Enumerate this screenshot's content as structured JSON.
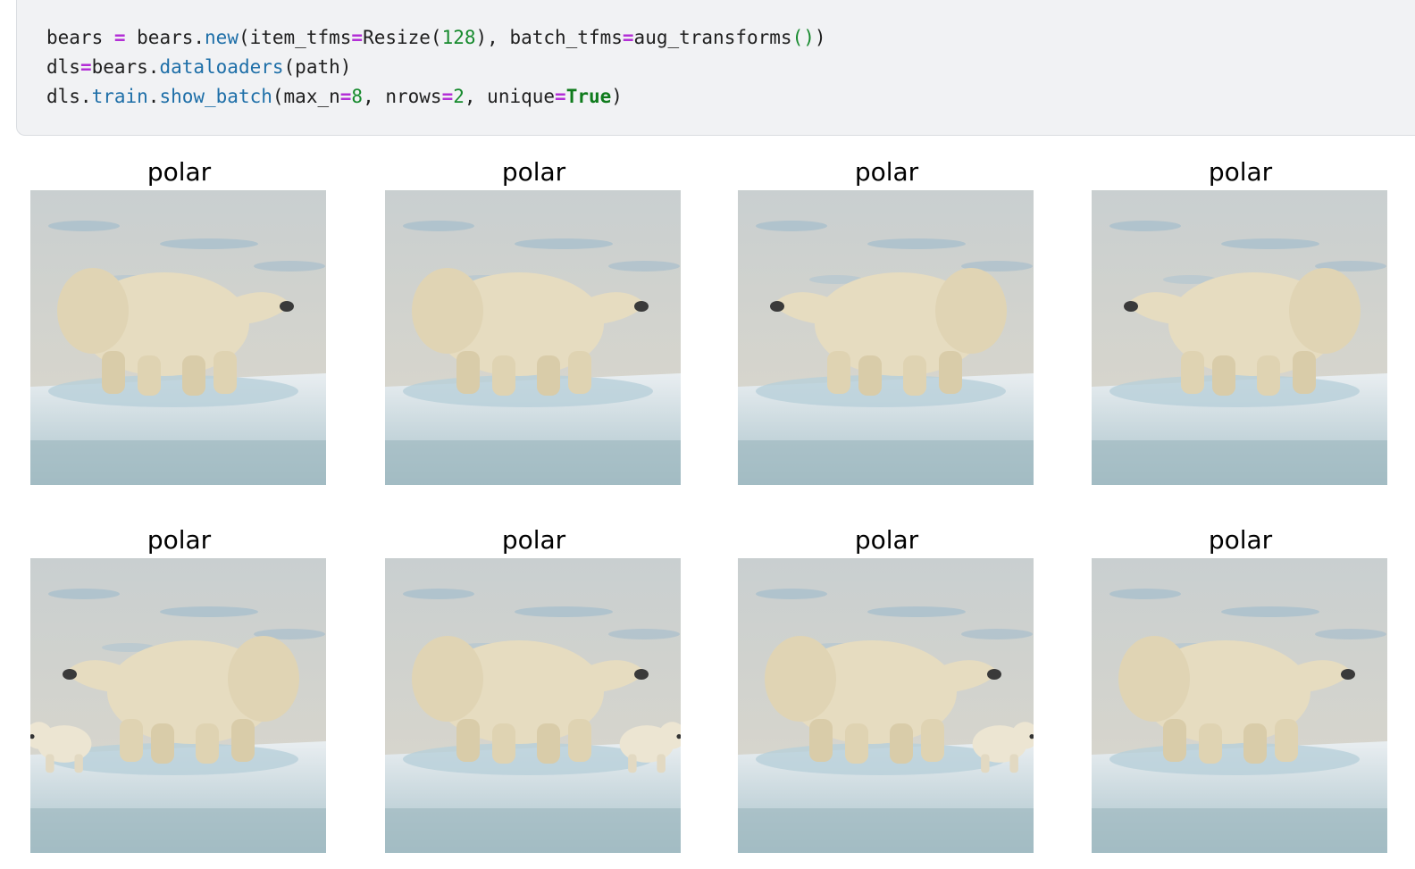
{
  "code_cell": {
    "lines": [
      [
        {
          "t": "bears ",
          "c": ""
        },
        {
          "t": "=",
          "c": "op"
        },
        {
          "t": " bears.",
          "c": ""
        },
        {
          "t": "new",
          "c": "fn"
        },
        {
          "t": "(item_tfms",
          "c": ""
        },
        {
          "t": "=",
          "c": "op"
        },
        {
          "t": "Resize(",
          "c": ""
        },
        {
          "t": "128",
          "c": "num"
        },
        {
          "t": "), batch_tfms",
          "c": ""
        },
        {
          "t": "=",
          "c": "op"
        },
        {
          "t": "aug_transforms",
          "c": ""
        },
        {
          "t": "()",
          "c": "paren-green"
        },
        {
          "t": ")",
          "c": ""
        }
      ],
      [
        {
          "t": "dls",
          "c": ""
        },
        {
          "t": "=",
          "c": "op"
        },
        {
          "t": "bears.",
          "c": ""
        },
        {
          "t": "dataloaders",
          "c": "fn"
        },
        {
          "t": "(path)",
          "c": ""
        }
      ],
      [
        {
          "t": "dls.",
          "c": ""
        },
        {
          "t": "train",
          "c": "fn"
        },
        {
          "t": ".",
          "c": ""
        },
        {
          "t": "show_batch",
          "c": "fn"
        },
        {
          "t": "(max_n",
          "c": ""
        },
        {
          "t": "=",
          "c": "op"
        },
        {
          "t": "8",
          "c": "num"
        },
        {
          "t": ", nrows",
          "c": ""
        },
        {
          "t": "=",
          "c": "op"
        },
        {
          "t": "2",
          "c": "num"
        },
        {
          "t": ", unique",
          "c": ""
        },
        {
          "t": "=",
          "c": "op"
        },
        {
          "t": "True",
          "c": "kw"
        },
        {
          "t": ")",
          "c": ""
        }
      ]
    ]
  },
  "batch": {
    "rows": 2,
    "items": [
      {
        "label": "polar",
        "facing": "right",
        "cub": false
      },
      {
        "label": "polar",
        "facing": "right",
        "cub": false
      },
      {
        "label": "polar",
        "facing": "left",
        "cub": false
      },
      {
        "label": "polar",
        "facing": "left",
        "cub": false
      },
      {
        "label": "polar",
        "facing": "left",
        "cub": true
      },
      {
        "label": "polar",
        "facing": "right",
        "cub": true
      },
      {
        "label": "polar",
        "facing": "right",
        "cub": true
      },
      {
        "label": "polar",
        "facing": "right",
        "cub": false
      }
    ]
  },
  "colors": {
    "code_bg": "#f1f2f4",
    "keyword": "#0f7b1c",
    "function": "#1e6fa8",
    "operator": "#b32fd6",
    "number": "#168a2d"
  }
}
